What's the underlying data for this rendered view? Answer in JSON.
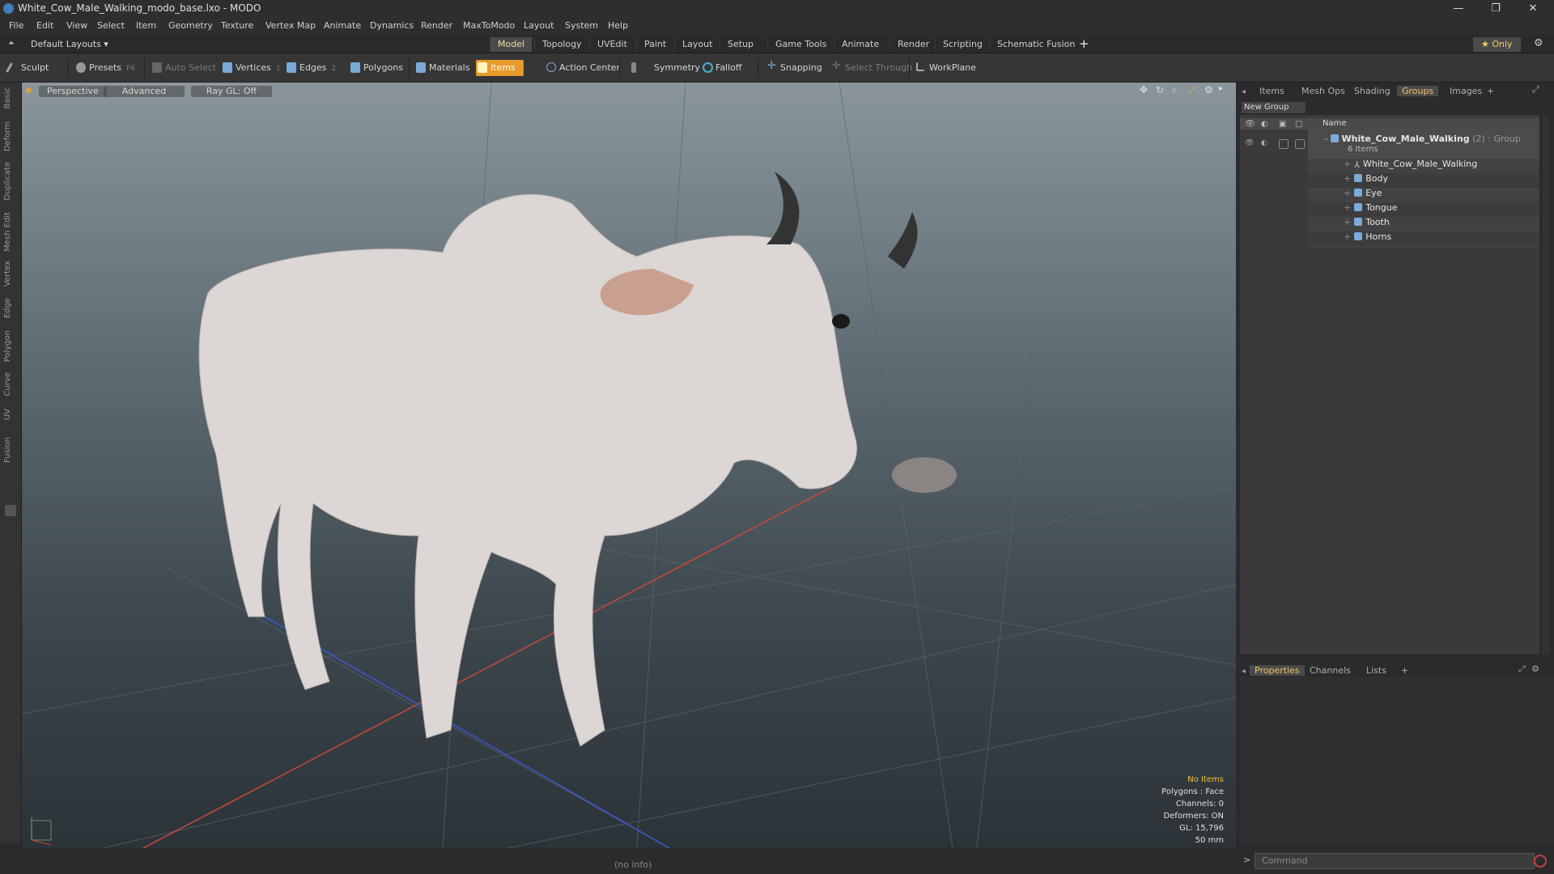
{
  "window": {
    "title": "White_Cow_Male_Walking_modo_base.lxo - MODO",
    "minimize": "—",
    "restore": "❐",
    "close": "✕"
  },
  "menu": [
    "File",
    "Edit",
    "View",
    "Select",
    "Item",
    "Geometry",
    "Texture",
    "Vertex Map",
    "Animate",
    "Dynamics",
    "Render",
    "MaxToModo",
    "Layout",
    "System",
    "Help"
  ],
  "layout_bar": {
    "layouts_label": "Default Layouts ▾",
    "tabs": [
      "Model",
      "Topology",
      "UVEdit",
      "Paint",
      "Layout",
      "Setup",
      "Game Tools",
      "Animate",
      "Render",
      "Scripting",
      "Schematic Fusion"
    ],
    "active_tab": "Model",
    "add_tab": "+",
    "only_label": "★ Only"
  },
  "toolbar": {
    "sculpt": "Sculpt",
    "presets": "Presets",
    "presets_key": "F6",
    "auto_select": "Auto Select",
    "vertices": "Vertices",
    "vertices_num": "1",
    "edges": "Edges",
    "edges_num": "2",
    "polygons": "Polygons",
    "materials": "Materials",
    "items": "Items",
    "action_center": "Action Center",
    "symmetry": "Symmetry",
    "falloff": "Falloff",
    "snapping": "Snapping",
    "select_through": "Select Through",
    "workplane": "WorkPlane"
  },
  "left_tabs": [
    "Basic",
    "Deform",
    "Duplicate",
    "Mesh Edit",
    "Vertex",
    "Edge",
    "Polygon",
    "Curve",
    "UV",
    "Fusion"
  ],
  "viewport": {
    "view_type": "Perspective",
    "shading": "Advanced",
    "raygl": "Ray GL: Off",
    "info": {
      "selection": "No Items",
      "polygons": "Polygons : Face",
      "channels": "Channels: 0",
      "deformers": "Deformers: ON",
      "gl": "GL: 15,796",
      "focal": "50 mm"
    },
    "status": "(no info)"
  },
  "right_panel": {
    "tabs": [
      "Items",
      "Mesh Ops",
      "Shading",
      "Groups",
      "Images"
    ],
    "active_tab": "Groups",
    "add_tab": "+",
    "new_group": "New Group",
    "column_name": "Name",
    "group": {
      "name": "White_Cow_Male_Walking",
      "count": "(2)",
      "type": ": Group",
      "items_count": "6 Items"
    },
    "children": [
      "White_Cow_Male_Walking",
      "Body",
      "Eye",
      "Tongue",
      "Tooth",
      "Horns"
    ]
  },
  "bottom_panel": {
    "tabs": [
      "Properties",
      "Channels",
      "Lists"
    ],
    "active_tab": "Properties",
    "add_tab": "+"
  },
  "command": {
    "prompt": ">",
    "placeholder": "Command"
  },
  "colors": {
    "accent": "#f0c060",
    "items_active": "#e89a2a",
    "viewport_top": "#8a969c",
    "viewport_bottom": "#2c3338"
  }
}
